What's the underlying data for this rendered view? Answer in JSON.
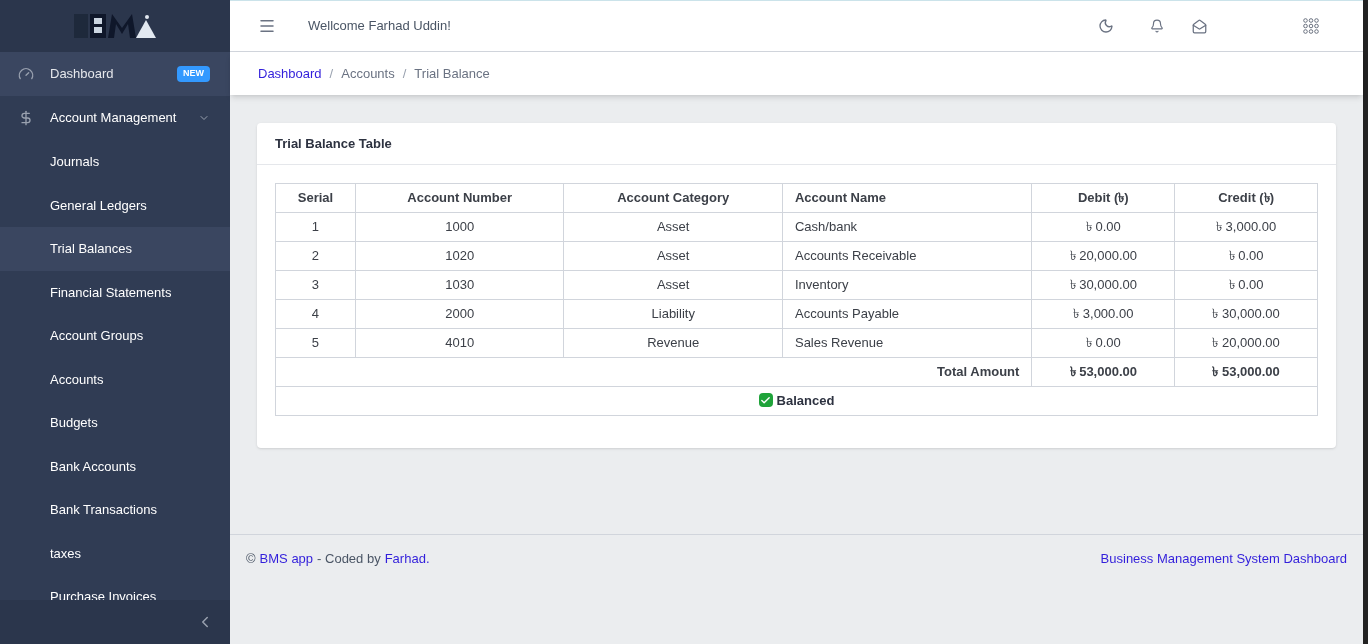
{
  "sidebar": {
    "items": [
      {
        "label": "Dashboard",
        "badge": "NEW",
        "selected": true,
        "expanded": false
      },
      {
        "label": "Account Management",
        "selected": false,
        "expanded": true,
        "children": [
          {
            "label": "Journals",
            "selected": false
          },
          {
            "label": "General Ledgers",
            "selected": false
          },
          {
            "label": "Trial Balances",
            "selected": true
          },
          {
            "label": "Financial Statements",
            "selected": false
          },
          {
            "label": "Account Groups",
            "selected": false
          },
          {
            "label": "Accounts",
            "selected": false
          },
          {
            "label": "Budgets",
            "selected": false
          },
          {
            "label": "Bank Accounts",
            "selected": false
          },
          {
            "label": "Bank Transactions",
            "selected": false
          },
          {
            "label": "taxes",
            "selected": false
          },
          {
            "label": "Purchase Invoices",
            "selected": false
          }
        ]
      }
    ]
  },
  "header": {
    "greeting": "Wellcome Farhad Uddin!"
  },
  "breadcrumb": [
    {
      "label": "Dashboard",
      "link": true,
      "separator": "/"
    },
    {
      "label": "Accounts",
      "link": false,
      "separator": "/"
    },
    {
      "label": "Trial Balance",
      "link": false
    }
  ],
  "card": {
    "title": "Trial Balance Table",
    "table": {
      "columns": [
        "Serial",
        "Account Number",
        "Account Category",
        "Account Name",
        "Debit (৳)",
        "Credit (৳)"
      ],
      "rows": [
        [
          "1",
          "1000",
          "Asset",
          "Cash/bank",
          "৳ 0.00",
          "৳ 3,000.00"
        ],
        [
          "2",
          "1020",
          "Asset",
          "Accounts Receivable",
          "৳ 20,000.00",
          "৳ 0.00"
        ],
        [
          "3",
          "1030",
          "Asset",
          "Inventory",
          "৳ 30,000.00",
          "৳ 0.00"
        ],
        [
          "4",
          "2000",
          "Liability",
          "Accounts Payable",
          "৳ 3,000.00",
          "৳ 30,000.00"
        ],
        [
          "5",
          "4010",
          "Revenue",
          "Sales Revenue",
          "৳ 0.00",
          "৳ 20,000.00"
        ]
      ],
      "total": {
        "label": "Total Amount",
        "debit": "৳ 53,000.00",
        "credit": "৳ 53,000.00"
      },
      "status": {
        "label": "Balanced",
        "checked": true
      }
    }
  },
  "footer": {
    "copyright": "©",
    "app_link": "BMS app",
    "coded_by": "- Coded by",
    "author_link": "Farhad",
    "period": ".",
    "right_link": "Business Management System Dashboard"
  }
}
